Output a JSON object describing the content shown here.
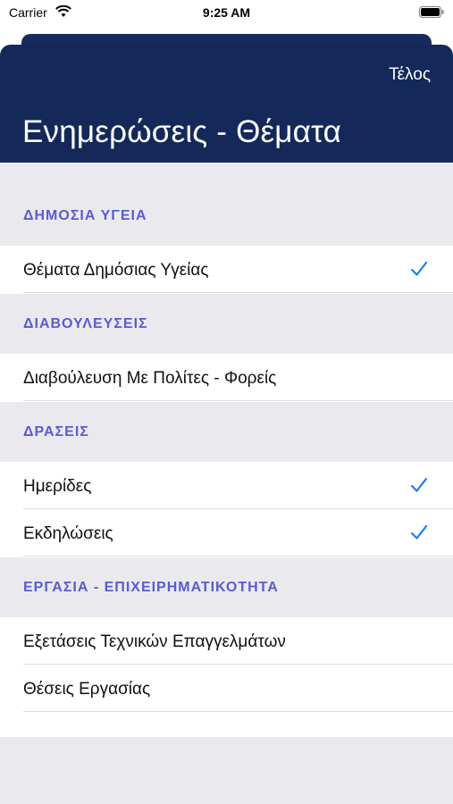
{
  "status": {
    "carrier": "Carrier",
    "time": "9:25 AM"
  },
  "header": {
    "done_label": "Τέλος",
    "title": "Ενημερώσεις - Θέματα"
  },
  "sections": [
    {
      "title": "ΔΗΜΟΣΙΑ ΥΓΕΙΑ",
      "items": [
        {
          "label": "Θέματα Δημόσιας Υγείας",
          "checked": true
        }
      ]
    },
    {
      "title": "ΔΙΑΒΟΥΛΕΥΣΕΙΣ",
      "items": [
        {
          "label": "Διαβούλευση Με Πολίτες - Φορείς",
          "checked": false
        }
      ]
    },
    {
      "title": "ΔΡΑΣΕΙΣ",
      "items": [
        {
          "label": "Ημερίδες",
          "checked": true
        },
        {
          "label": "Εκδηλώσεις",
          "checked": true
        }
      ]
    },
    {
      "title": "ΕΡΓΑΣΙΑ - ΕΠΙΧΕΙΡΗΜΑΤΙΚΟΤΗΤΑ",
      "items": [
        {
          "label": "Εξετάσεις Τεχνικών Επαγγελμάτων",
          "checked": false
        },
        {
          "label": "Θέσεις Εργασίας",
          "checked": false
        }
      ]
    }
  ],
  "colors": {
    "header_bg": "#14295a",
    "section_title": "#5a5ad9",
    "check": "#1a7cf5"
  },
  "icons": {
    "check": "check-icon",
    "wifi": "wifi-icon",
    "battery": "battery-icon"
  }
}
